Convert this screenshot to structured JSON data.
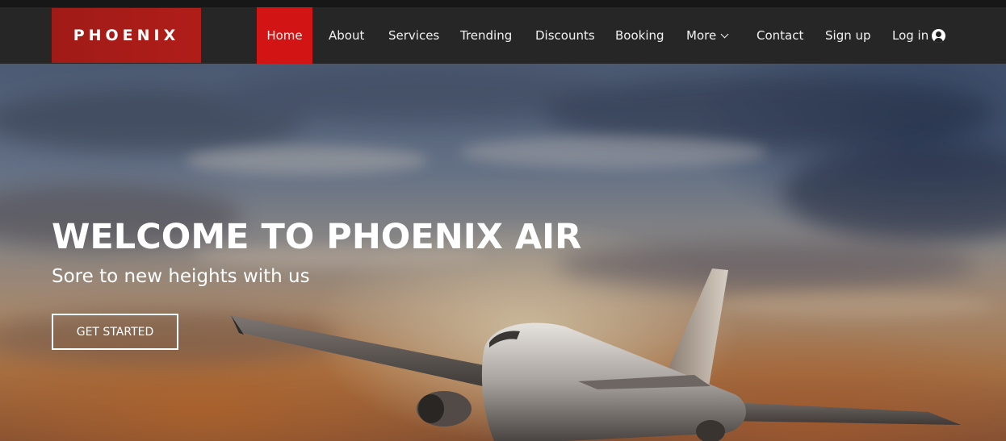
{
  "brand": {
    "name": "PHOENIX"
  },
  "nav": {
    "items": [
      {
        "label": "Home",
        "active": true
      },
      {
        "label": "About"
      },
      {
        "label": "Services"
      },
      {
        "label": "Trending"
      },
      {
        "label": "Discounts"
      },
      {
        "label": "Booking"
      },
      {
        "label": "More",
        "has_dropdown": true
      },
      {
        "label": "Contact"
      },
      {
        "label": "Sign up"
      },
      {
        "label": "Log in",
        "icon": "user-icon"
      }
    ]
  },
  "hero": {
    "title": "WELCOME TO PHOENIX AIR",
    "subtitle": "Sore to new heights with us",
    "cta_label": "GET STARTED"
  },
  "colors": {
    "navbar_bg": "#262626",
    "brand_bg": "#a01b17",
    "active_nav_bg": "#d21414",
    "text": "#ffffff"
  }
}
